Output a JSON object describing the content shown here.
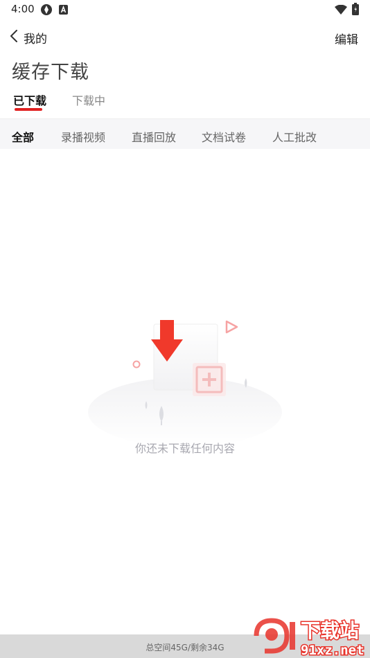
{
  "status_bar": {
    "time": "4:00"
  },
  "nav": {
    "back_label": "我的",
    "edit_label": "编辑"
  },
  "page": {
    "title": "缓存下载"
  },
  "tabs": [
    {
      "label": "已下载",
      "active": true
    },
    {
      "label": "下载中",
      "active": false
    }
  ],
  "filters": [
    {
      "label": "全部",
      "active": true
    },
    {
      "label": "录播视频",
      "active": false
    },
    {
      "label": "直播回放",
      "active": false
    },
    {
      "label": "文档试卷",
      "active": false
    },
    {
      "label": "人工批改",
      "active": false
    }
  ],
  "empty_state": {
    "message": "你还未下载任何内容"
  },
  "footer": {
    "storage_text": "总空间45G/剩余34G"
  },
  "watermark": {
    "logo_text": "下载站",
    "site_text": "91xz.net"
  },
  "colors": {
    "accent": "#e02020",
    "filter_bg": "#f6f6f8",
    "footer_bg": "#d9d9d9",
    "muted_text": "#a8a8b0"
  }
}
